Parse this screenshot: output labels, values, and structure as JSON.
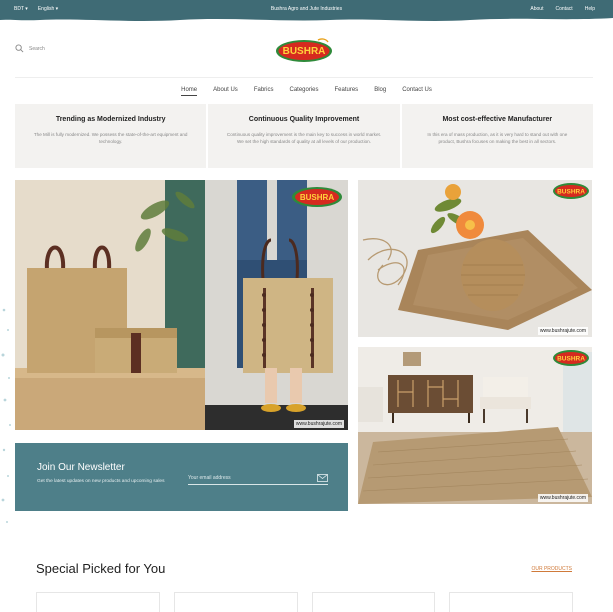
{
  "topbar": {
    "currency": "BDT",
    "language": "English",
    "company": "Bushra Agro and Jute Industries",
    "links": [
      "About",
      "Contact",
      "Help"
    ]
  },
  "search": {
    "placeholder": "Search"
  },
  "logo": {
    "text": "BUSHRA"
  },
  "nav": {
    "items": [
      "Home",
      "About Us",
      "Fabrics",
      "Categories",
      "Features",
      "Blog",
      "Contact Us"
    ],
    "active": "Home"
  },
  "features": [
    {
      "title": "Trending as Modernized Industry",
      "text": "The Mill is fully modernized. We possess the state-of-the-art equipment and technology."
    },
    {
      "title": "Continuous Quality Improvement",
      "text": "Continuous quality improvement is the main key to success in world market. We set the high standards of quality at all levels of our production."
    },
    {
      "title": "Most cost-effective Manufacturer",
      "text": "In this era of mass production, as it is very hard to stand out with one product, Bushra focuses on making the best in all sectors."
    }
  ],
  "banners": {
    "hero_url": "www.bushrajute.com",
    "tile1_url": "www.bushrajute.com",
    "tile2_url": "www.bushrajute.com"
  },
  "newsletter": {
    "title": "Join Our Newsletter",
    "subtitle": "Get the latest updates on new products and upcoming sales",
    "placeholder": "Your email address"
  },
  "special": {
    "title": "Special Picked for You",
    "link": "OUR PRODUCTS"
  },
  "colors": {
    "topbar": "#3f6b75",
    "newsletter": "#4e7f89",
    "logo_red": "#d62a1f",
    "logo_green": "#2f8a3a",
    "link_orange": "#d07a3a"
  }
}
